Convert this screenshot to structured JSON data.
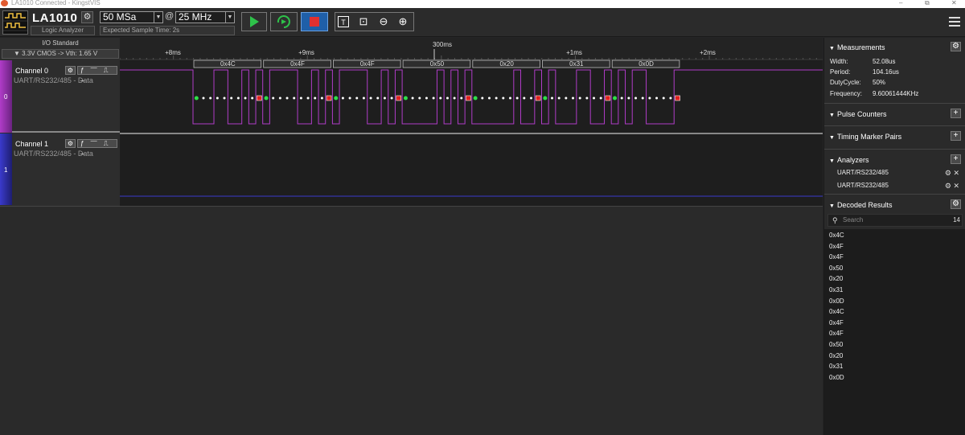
{
  "window": {
    "title": "LA1010 Connected - KingstVIS",
    "min_glyph": "–",
    "max_glyph": "⧉",
    "close_glyph": "✕"
  },
  "toolbar": {
    "device_name": "LA1010",
    "device_subtitle": "Logic Analyzer",
    "sample_depth": "50 MSa",
    "at_sign": "@",
    "sample_rate": "25 MHz",
    "expected_sample_time": "Expected Sample Time: 2s",
    "gear_glyph": "⚙",
    "dropdown_glyph": "▼",
    "text_tool_glyph": "T",
    "zoom_fit_glyph": "⊡",
    "zoom_out_glyph": "⊖",
    "zoom_in_glyph": "⊕"
  },
  "io_panel": {
    "header": "I/O Standard",
    "standard": "▼ 3.3V CMOS -> Vth: 1.65 V"
  },
  "channels": [
    {
      "name": "Channel 0",
      "decoder": "UART/RS232/485 - Data",
      "index": "0",
      "color": "#b03cc8"
    },
    {
      "name": "Channel 1",
      "decoder": "UART/RS232/485 - Data",
      "index": "1",
      "color": "#3a3acc"
    }
  ],
  "timeline": {
    "top_label": "300ms",
    "labels": [
      "+8ms",
      "+9ms",
      "+1ms",
      "+2ms"
    ]
  },
  "decoded_packets": [
    "0x4C",
    "0x4F",
    "0x4F",
    "0x50",
    "0x20",
    "0x31",
    "0x0D"
  ],
  "measurements": {
    "title": "Measurements",
    "rows": [
      {
        "label": "Width:",
        "value": "52.08us"
      },
      {
        "label": "Period:",
        "value": "104.16us"
      },
      {
        "label": "DutyCycle:",
        "value": "50%"
      },
      {
        "label": "Frequency:",
        "value": "9.60061444KHz"
      }
    ]
  },
  "sections": {
    "pulse_counters": "Pulse Counters",
    "timing_marker_pairs": "Timing Marker Pairs",
    "analyzers": "Analyzers",
    "decoded_results": "Decoded Results"
  },
  "analyzers": [
    "UART/RS232/485",
    "UART/RS232/485"
  ],
  "search": {
    "placeholder": "Search",
    "count": "14"
  },
  "decoded_results": [
    "0x4C",
    "0x4F",
    "0x4F",
    "0x50",
    "0x20",
    "0x31",
    "0x0D",
    "0x4C",
    "0x4F",
    "0x4F",
    "0x50",
    "0x20",
    "0x31",
    "0x0D"
  ]
}
